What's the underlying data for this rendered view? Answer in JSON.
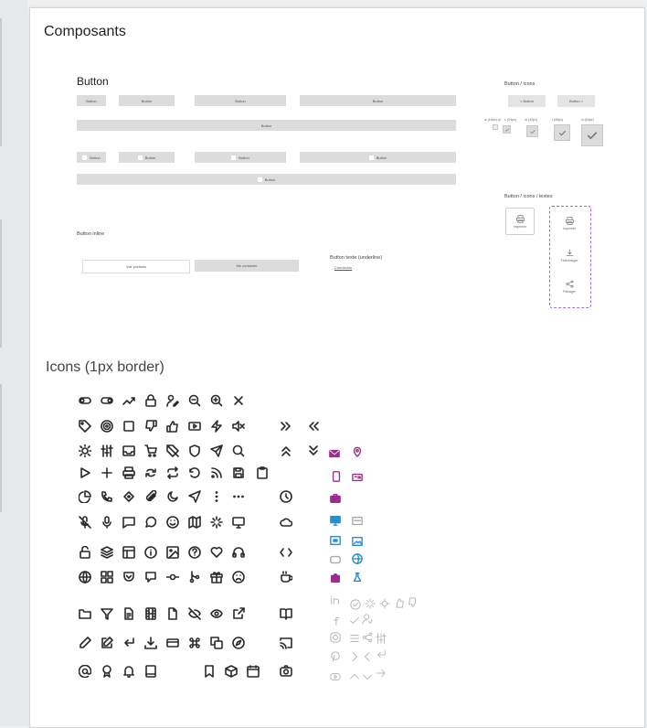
{
  "page": {
    "title": "Composants"
  },
  "buttons": {
    "heading": "Button",
    "label": "Button",
    "row1": [
      "Button",
      "Button",
      "Button",
      "Button"
    ],
    "full": "Button",
    "row2": [
      "Button",
      "Button",
      "Button",
      "Button"
    ],
    "full2": "Button"
  },
  "button_icons": {
    "heading": "Button / icons",
    "prev": "< Button",
    "next": "Button >",
    "sizes": [
      "w (16px) ct",
      "s (24px)",
      "m (32px)",
      "l (40px)",
      "xl (64px)"
    ]
  },
  "button_icons_textes": {
    "heading": "Button / icons / textes",
    "items": [
      "Imprimer",
      "Imprimer",
      "Télécharger",
      "Partager"
    ]
  },
  "button_inline": {
    "heading": "Button inline",
    "items": [
      "Voir portfolio",
      "Me contacter"
    ]
  },
  "button_underline": {
    "heading": "Button texte (underline)",
    "item": "Connexion"
  },
  "icons_section": {
    "title": "Icons (1px border)"
  },
  "colors": {
    "accent": "#9b2d8c",
    "blue": "#2a8cc9",
    "gray": "#bbbbbb",
    "dark": "#2a2a2a"
  },
  "icon_grid": [
    [
      "toggle-off-icon",
      "toggle-on-icon",
      "trending-icon",
      "lock-icon",
      "user-edit-icon",
      "zoom-out-icon",
      "zoom-in-icon",
      "close-icon"
    ],
    [
      "tag-icon",
      "target-icon",
      "square-icon",
      "thumb-down-icon",
      "thumb-up-icon",
      "video-icon",
      "flash-icon",
      "mute-icon",
      "chevrons-right-icon",
      "chevrons-left-icon"
    ],
    [
      "sun-icon",
      "sliders-icon",
      "inbox-icon",
      "cart-icon",
      "tag-off-icon",
      "shield-icon",
      "send-icon",
      "search-icon",
      "chevrons-up-icon",
      "chevrons-down-icon"
    ],
    [
      "play-icon",
      "plus-icon",
      "print-icon",
      "refresh-icon",
      "repeat-icon",
      "redo-icon",
      "rss-icon",
      "save-icon",
      "clipboard-icon"
    ],
    [
      "pie-chart-icon",
      "phone-icon",
      "pen-tool-icon",
      "paperclip-icon",
      "moon-icon",
      "navigation-icon",
      "more-vertical-icon",
      "more-horizontal-icon",
      "clock-icon"
    ],
    [
      "mic-off-icon",
      "mic-icon",
      "message-square-icon",
      "message-circle-icon",
      "smile-icon",
      "map-icon",
      "loader-icon",
      "monitor-icon",
      "cloud-icon"
    ],
    [
      "unlock-icon",
      "layers-icon",
      "layout-icon",
      "info-icon",
      "image-icon",
      "help-icon",
      "heart-icon",
      "headphones-icon",
      "code-icon"
    ],
    [
      "globe-icon",
      "grid-icon",
      "pocket-icon",
      "message-alt-icon",
      "git-commit-icon",
      "git-merge-icon",
      "gift-icon",
      "frown-icon",
      "coffee-icon"
    ],
    [
      "folder-icon",
      "filter-icon",
      "file-text-icon",
      "film-icon",
      "file-icon",
      "eye-off-icon",
      "eye-icon",
      "external-link-icon",
      "book-open-icon"
    ],
    [
      "edit-icon",
      "edit-square-icon",
      "corner-down-left-icon",
      "download-icon",
      "credit-card-icon",
      "command-icon",
      "copy-icon",
      "compass-icon",
      "cast-icon"
    ],
    [
      "at-sign-icon",
      "award-icon",
      "bell-icon",
      "tablet-icon",
      "bookmark-icon",
      "box-icon",
      "calendar-icon",
      "camera-icon"
    ]
  ]
}
